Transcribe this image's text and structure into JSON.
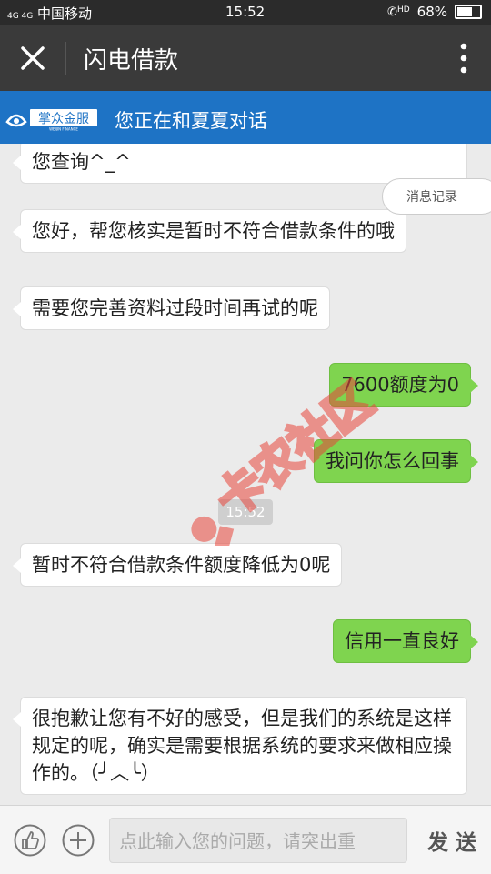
{
  "status_bar": {
    "carrier": "中国移动",
    "signal_text": "4G 4G",
    "time": "15:52",
    "hd": "HD",
    "battery": "68%"
  },
  "header": {
    "title": "闪电借款"
  },
  "banner": {
    "logo_text": "掌众金服",
    "logo_subtext": "WEIJIN FINANCE",
    "text": "您正在和夏夏对话"
  },
  "history_button": "消息记录",
  "messages": [
    {
      "side": "left",
      "text": "您查询^_^"
    },
    {
      "side": "left",
      "text": "您好，帮您核实是暂时不符合借款条件的哦"
    },
    {
      "side": "left",
      "text": "需要您完善资料过段时间再试的呢"
    },
    {
      "side": "right",
      "text": "7600额度为0"
    },
    {
      "side": "right",
      "text": "我问你怎么回事"
    },
    {
      "side": "left",
      "text": "暂时不符合借款条件额度降低为0呢"
    },
    {
      "side": "right",
      "text": "信用一直良好"
    },
    {
      "side": "left",
      "text": "很抱歉让您有不好的感受，但是我们的系统是这样规定的呢，确实是需要根据系统的要求来做相应操作的。（╯︿╰）"
    }
  ],
  "time_divider": "15:52",
  "watermark": "卡农社区",
  "input": {
    "placeholder": "点此输入您的问题，请突出重"
  },
  "send_label": "发 送",
  "colors": {
    "header": "#3a3a3a",
    "banner": "#1e73c5",
    "my_bubble": "#7fd44f",
    "watermark": "#e8463c"
  }
}
